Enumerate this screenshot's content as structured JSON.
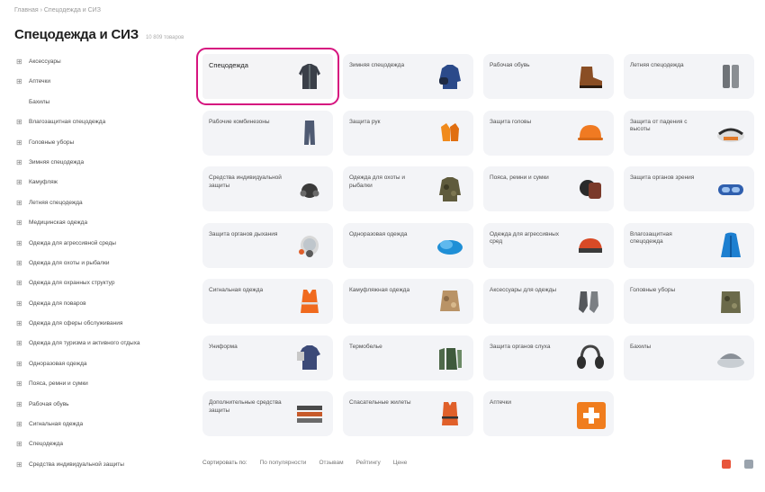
{
  "breadcrumb": "Главная › Спецодежда и СИЗ",
  "title": "Спецодежда и СИЗ",
  "count": "10 809 товаров",
  "sidebar": [
    {
      "label": "Аксессуары",
      "plus": true
    },
    {
      "label": "Аптечки",
      "plus": true
    },
    {
      "label": "Бахилы",
      "plus": false
    },
    {
      "label": "Влагозащитная спецодежда",
      "plus": true
    },
    {
      "label": "Головные уборы",
      "plus": true
    },
    {
      "label": "Зимняя спецодежда",
      "plus": true
    },
    {
      "label": "Камуфляж",
      "plus": true
    },
    {
      "label": "Летняя спецодежда",
      "plus": true
    },
    {
      "label": "Медицинская одежда",
      "plus": true
    },
    {
      "label": "Одежда для агрессивной среды",
      "plus": true
    },
    {
      "label": "Одежда для охоты и рыбалки",
      "plus": true
    },
    {
      "label": "Одежда для охранных структур",
      "plus": true
    },
    {
      "label": "Одежда для поваров",
      "plus": true
    },
    {
      "label": "Одежда для сферы обслуживания",
      "plus": true
    },
    {
      "label": "Одежда для туризма и активного отдыха",
      "plus": true
    },
    {
      "label": "Одноразовая одежда",
      "plus": true
    },
    {
      "label": "Пояса, ремни и сумки",
      "plus": true
    },
    {
      "label": "Рабочая обувь",
      "plus": true
    },
    {
      "label": "Сигнальная одежда",
      "plus": true
    },
    {
      "label": "Спецодежда",
      "plus": true
    },
    {
      "label": "Средства индивидуальной защиты",
      "plus": true
    }
  ],
  "categories": [
    {
      "label": "Спецодежда",
      "icon": "jacket-icon",
      "color": "#3a3f48"
    },
    {
      "label": "Зимняя спецодежда",
      "icon": "winter-jacket-icon",
      "color": "#2b4a8a"
    },
    {
      "label": "Рабочая обувь",
      "icon": "boot-icon",
      "color": "#8a4e24"
    },
    {
      "label": "Летняя спецодежда",
      "icon": "overalls-icon",
      "color": "#6f7378"
    },
    {
      "label": "Рабочие комбинезоны",
      "icon": "coverall-icon",
      "color": "#4e5a72"
    },
    {
      "label": "Защита рук",
      "icon": "gloves-icon",
      "color": "#f08a1c"
    },
    {
      "label": "Защита головы",
      "icon": "helmet-icon",
      "color": "#f07a22"
    },
    {
      "label": "Защита от падения с высоты",
      "icon": "harness-icon",
      "color": "#2c2c2c"
    },
    {
      "label": "Средства индивидуальной защиты",
      "icon": "respirator-icon",
      "color": "#3a3a3a"
    },
    {
      "label": "Одежда для охоты и рыбалки",
      "icon": "camo-jacket-icon",
      "color": "#5f5b3c"
    },
    {
      "label": "Пояса, ремни и сумки",
      "icon": "bag-icon",
      "color": "#7a3a2a"
    },
    {
      "label": "Защита органов зрения",
      "icon": "goggles-icon",
      "color": "#2f5fae"
    },
    {
      "label": "Защита органов дыхания",
      "icon": "gas-mask-icon",
      "color": "#5a5a5a"
    },
    {
      "label": "Одноразовая одежда",
      "icon": "disposable-cap-icon",
      "color": "#1f8fd6"
    },
    {
      "label": "Одежда для агрессивных сред",
      "icon": "helmet-visor-icon",
      "color": "#d84a26"
    },
    {
      "label": "Влагозащитная спецодежда",
      "icon": "raincoat-icon",
      "color": "#1d7fd0"
    },
    {
      "label": "Сигнальная одежда",
      "icon": "vest-icon",
      "color": "#f06a1e"
    },
    {
      "label": "Камуфляжная одежда",
      "icon": "camo-suit-icon",
      "color": "#b99366"
    },
    {
      "label": "Аксессуары для одежды",
      "icon": "socks-icon",
      "color": "#55585c"
    },
    {
      "label": "Головные уборы",
      "icon": "camo-hat-icon",
      "color": "#6b6a4a"
    },
    {
      "label": "Униформа",
      "icon": "uniform-icon",
      "color": "#3c4a78"
    },
    {
      "label": "Термобелье",
      "icon": "thermal-icon",
      "color": "#4f6a4a"
    },
    {
      "label": "Защита органов слуха",
      "icon": "earmuffs-icon",
      "color": "#2e2e2e"
    },
    {
      "label": "Бахилы",
      "icon": "shoe-covers-icon",
      "color": "#8a9098"
    },
    {
      "label": "Дополнительные средства защиты",
      "icon": "shelf-icon",
      "color": "#c75a2a"
    },
    {
      "label": "Спасательные жилеты",
      "icon": "life-vest-icon",
      "color": "#e0602a"
    },
    {
      "label": "Аптечки",
      "icon": "first-aid-kit-icon",
      "color": "#f07d1e"
    }
  ],
  "sort": {
    "label": "Сортировать по:",
    "options": [
      "По популярности",
      "Отзывам",
      "Рейтингу",
      "Цене"
    ]
  },
  "view": {
    "grid_color": "#e8553b",
    "list_color": "#9aa3ad"
  }
}
